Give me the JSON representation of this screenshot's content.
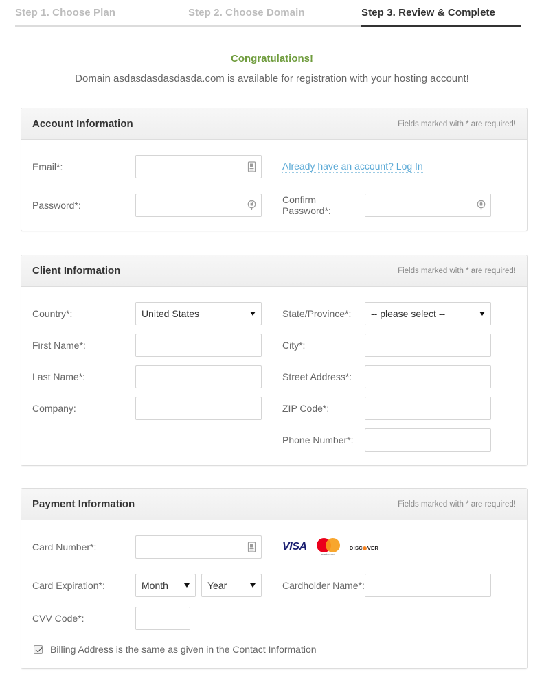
{
  "steps": [
    {
      "label": "Step 1. Choose Plan",
      "active": false
    },
    {
      "label": "Step 2. Choose Domain",
      "active": false
    },
    {
      "label": "Step 3. Review & Complete",
      "active": true
    }
  ],
  "banner": {
    "congrats": "Congratulations!",
    "domain_message": "Domain asdasdasdasdasda.com is available for registration with your hosting account!",
    "congrats_color": "#6f9c3d"
  },
  "required_note": "Fields marked with * are required!",
  "account": {
    "title": "Account Information",
    "email_label": "Email*:",
    "email_value": "",
    "email_icon": "contact-card-icon",
    "login_link": "Already have an account? Log In",
    "login_link_color": "#5aa9d6",
    "password_label": "Password*:",
    "password_value": "",
    "password_icon": "lock-icon",
    "confirm_password_label": "Confirm Password*:",
    "confirm_password_value": "",
    "confirm_password_icon": "lock-icon"
  },
  "client": {
    "title": "Client Information",
    "country_label": "Country*:",
    "country_value": "United States",
    "state_label": "State/Province*:",
    "state_value": "-- please select --",
    "first_name_label": "First Name*:",
    "first_name_value": "",
    "city_label": "City*:",
    "city_value": "",
    "last_name_label": "Last Name*:",
    "last_name_value": "",
    "street_label": "Street Address*:",
    "street_value": "",
    "company_label": "Company:",
    "company_value": "",
    "zip_label": "ZIP Code*:",
    "zip_value": "",
    "phone_label": "Phone Number*:",
    "phone_value": ""
  },
  "payment": {
    "title": "Payment Information",
    "card_number_label": "Card Number*:",
    "card_number_value": "",
    "card_number_icon": "card-icon",
    "card_logos": [
      {
        "name": "visa-logo",
        "label": "VISA",
        "color": "#1a1f71"
      },
      {
        "name": "mastercard-logo",
        "label": "mastercard",
        "color": "#eb001b"
      },
      {
        "name": "discover-logo",
        "label": "DISC VER",
        "color": "#f58220"
      }
    ],
    "expiration_label": "Card Expiration*:",
    "month_value": "Month",
    "year_value": "Year",
    "cardholder_label": "Cardholder Name*:",
    "cardholder_value": "",
    "cvv_label": "CVV Code*:",
    "cvv_value": "",
    "billing_checkbox_label": "Billing Address is the same as given in the Contact Information",
    "billing_checked": true
  }
}
